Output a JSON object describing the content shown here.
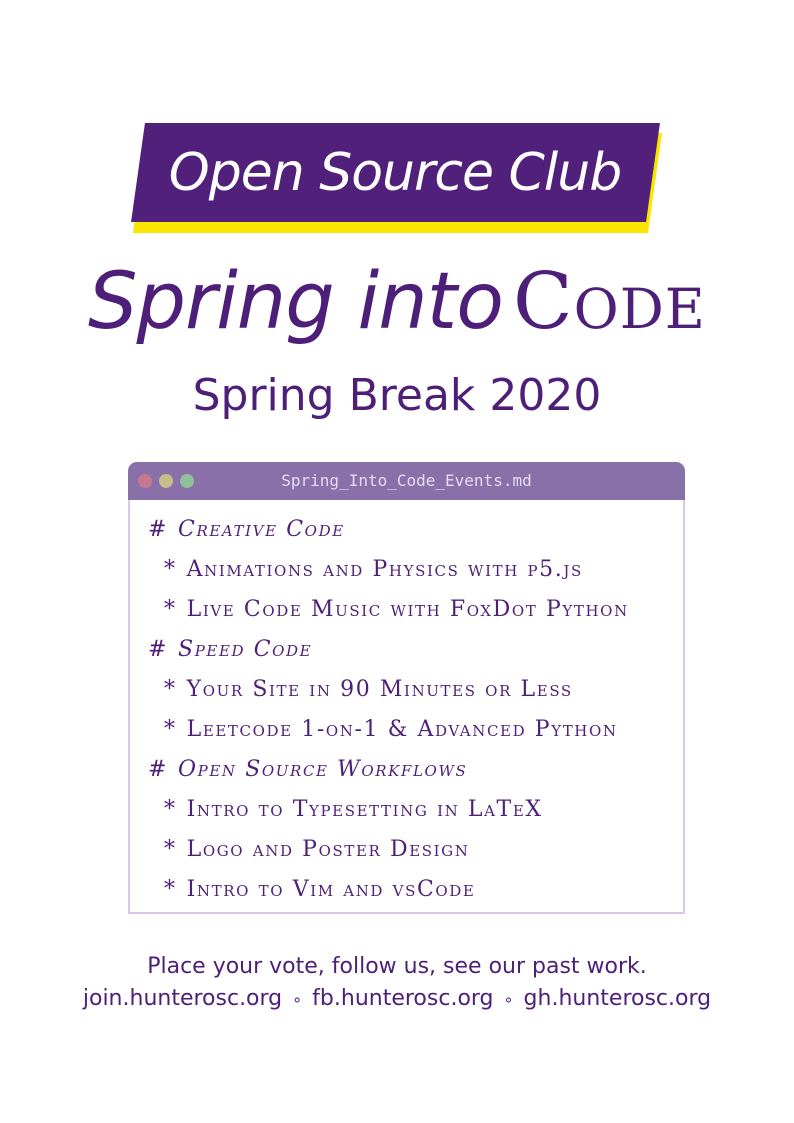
{
  "banner": {
    "title": "Open Source Club"
  },
  "title": {
    "part1": "Spring into",
    "part2": "Code"
  },
  "subtitle": "Spring Break 2020",
  "window": {
    "filename": "Spring_Into_Code_Events.md",
    "lines": [
      {
        "marker": "#",
        "text": "Creative Code"
      },
      {
        "marker": "*",
        "text": "Animations and Physics with p5.js"
      },
      {
        "marker": "*",
        "text": "Live Code Music with FoxDot Python"
      },
      {
        "marker": "#",
        "text": "Speed Code"
      },
      {
        "marker": "*",
        "text": "Your Site in 90 Minutes or Less"
      },
      {
        "marker": "*",
        "text": "Leetcode 1-on-1 & Advanced Python"
      },
      {
        "marker": "#",
        "text": "Open Source Workflows"
      },
      {
        "marker": "*",
        "text": "Intro to Typesetting in LaTeX"
      },
      {
        "marker": "*",
        "text": "Logo and Poster Design"
      },
      {
        "marker": "*",
        "text": "Intro to Vim and vsCode"
      }
    ]
  },
  "footer": {
    "tagline": "Place your vote, follow us, see our past work.",
    "links": [
      "join.hunterosc.org",
      "fb.hunterosc.org",
      "gh.hunterosc.org"
    ],
    "separator": "∘"
  },
  "colors": {
    "brand_purple": "#50207a",
    "accent_yellow": "#fbe600",
    "titlebar": "#8a70a8"
  }
}
